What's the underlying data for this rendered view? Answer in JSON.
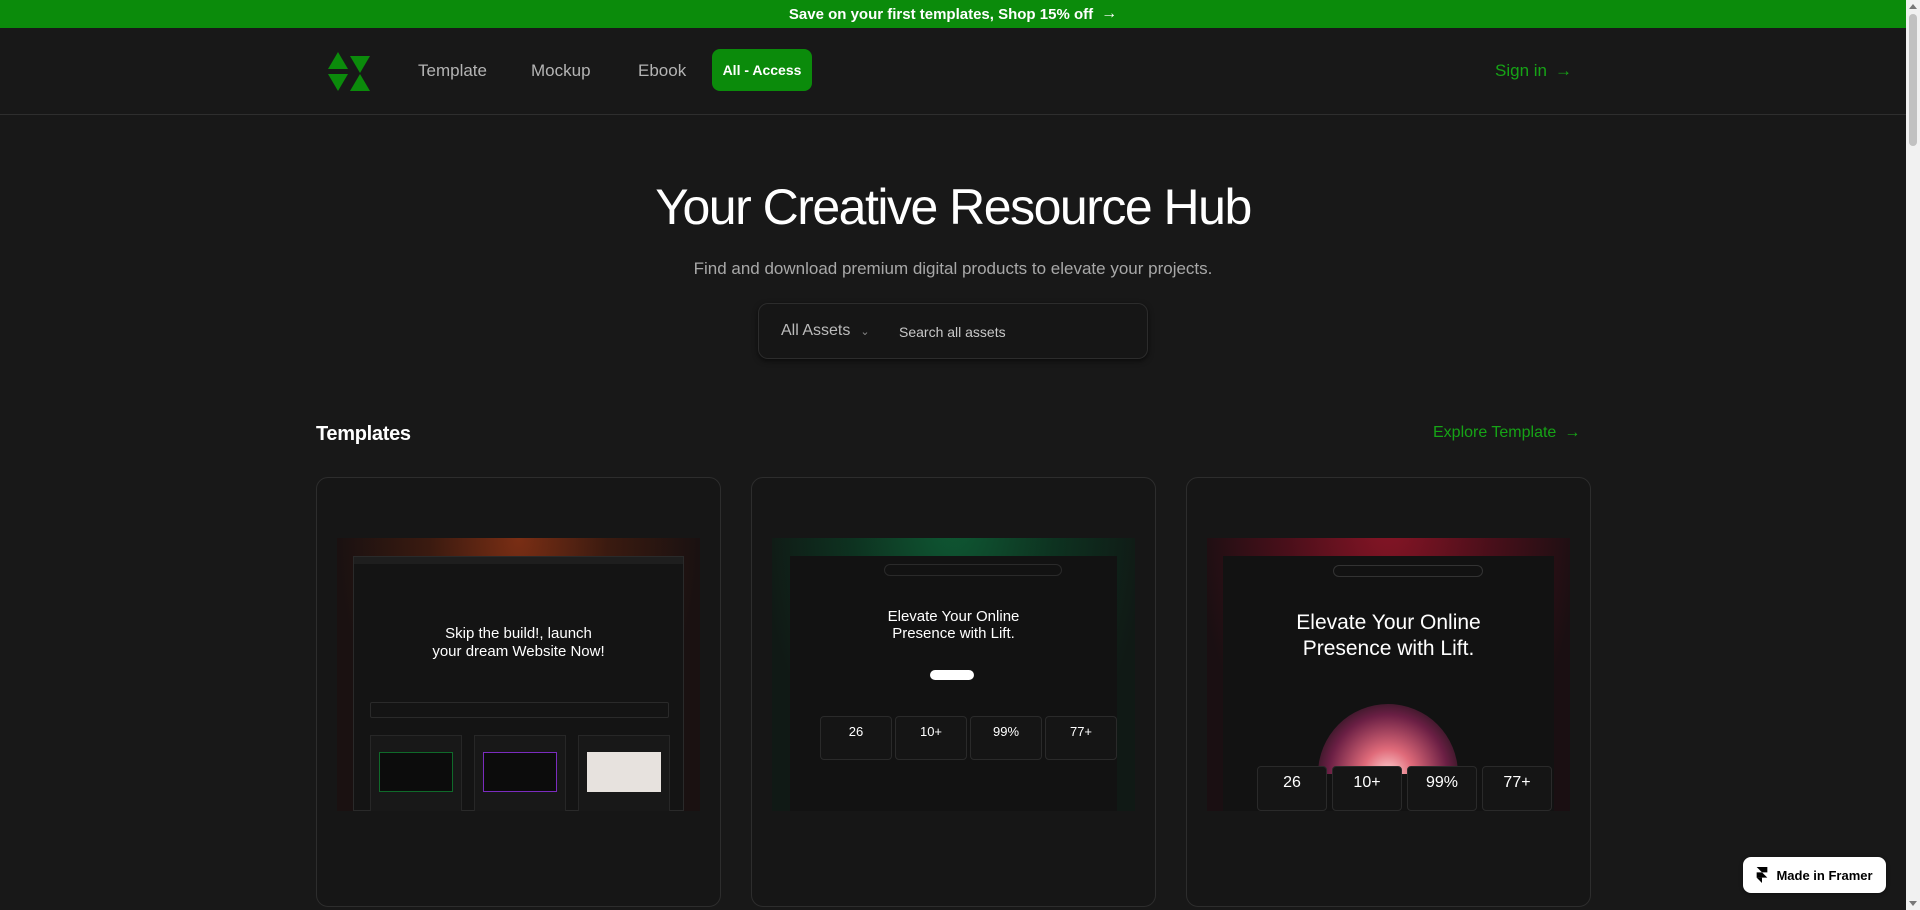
{
  "promo": {
    "text": "Save on your first templates, Shop 15% off",
    "arrow": "→"
  },
  "nav": {
    "links": [
      "Template",
      "Mockup",
      "Ebook"
    ],
    "cta": "All - Access",
    "signin": "Sign in",
    "arrow": "→"
  },
  "hero": {
    "title": "Your Creative Resource Hub",
    "subtitle": "Find and download premium digital products to elevate your projects."
  },
  "search": {
    "category": "All Assets",
    "placeholder": "Search all assets"
  },
  "templates": {
    "title": "Templates",
    "explore": "Explore Template",
    "cards": [
      {
        "headline_1": "Skip the build!, launch",
        "headline_2": "your dream Website Now!"
      },
      {
        "headline_1": "Elevate Your Online",
        "headline_2": "Presence with Lift.",
        "stats": [
          "26",
          "10+",
          "99%",
          "77+"
        ]
      },
      {
        "headline_1": "Elevate Your Online",
        "headline_2": "Presence with Lift.",
        "stats": [
          "26",
          "10+",
          "99%",
          "77+"
        ]
      }
    ]
  },
  "badge": {
    "label": "Made in Framer"
  },
  "colors": {
    "accent": "#0b8b0b",
    "accent_text": "#16a316",
    "background": "#181818"
  }
}
